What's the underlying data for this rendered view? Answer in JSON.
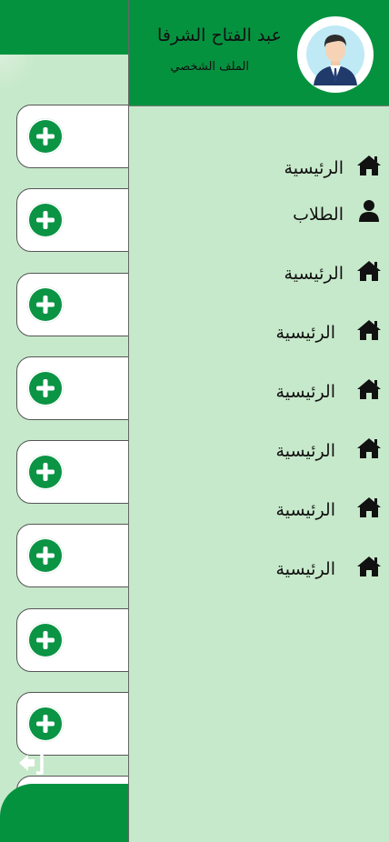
{
  "drawer": {
    "user_name": "عبد الفتاح الشرفا",
    "profile_link": "الملف الشخصي",
    "menu": [
      {
        "label": "الرئيسية",
        "icon": "home-icon"
      },
      {
        "label": "الطلاب",
        "icon": "user-icon"
      },
      {
        "label": "الرئيسية",
        "icon": "home-icon"
      },
      {
        "label": "الرئيسية",
        "icon": "home-icon"
      },
      {
        "label": "الرئيسية",
        "icon": "home-icon"
      },
      {
        "label": "الرئيسية",
        "icon": "home-icon"
      },
      {
        "label": "الرئيسية",
        "icon": "home-icon"
      },
      {
        "label": "الرئيسية",
        "icon": "home-icon"
      }
    ]
  },
  "background": {
    "add_button_icon": "plus-circle-icon",
    "add_button_count": 9,
    "logout_icon": "logout-icon"
  },
  "colors": {
    "primary": "#05923f",
    "background": "#c7e9cb",
    "card": "#ffffff",
    "text": "#111111"
  }
}
